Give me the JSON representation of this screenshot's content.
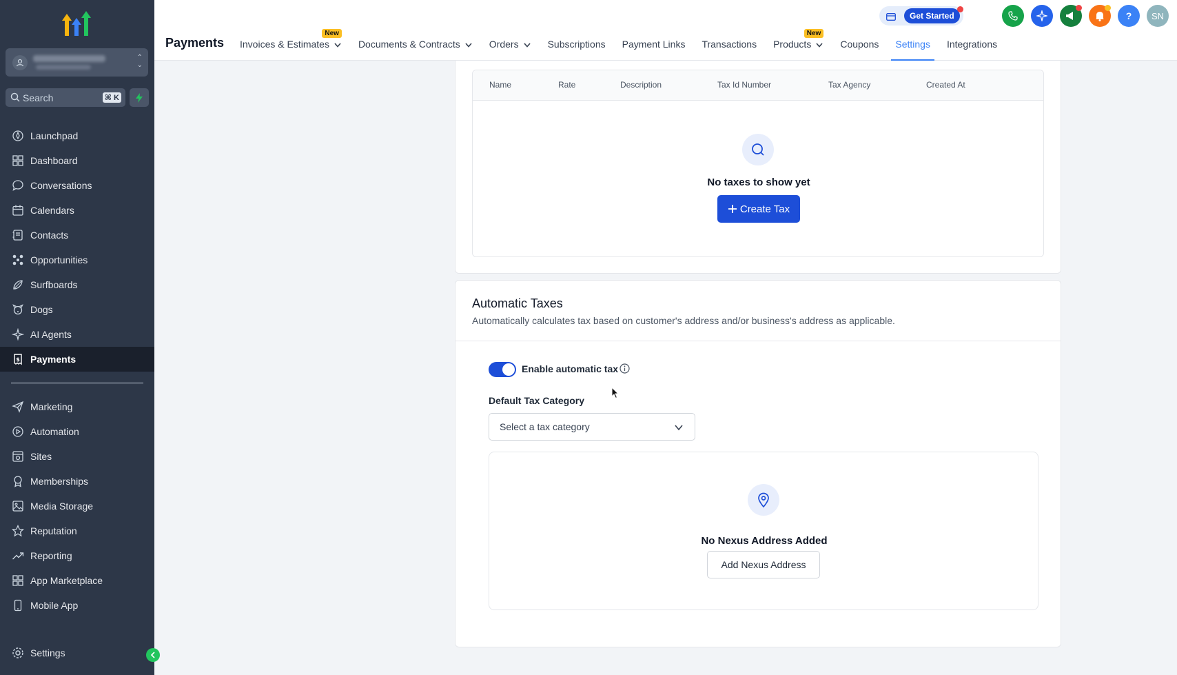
{
  "sidebar": {
    "search_placeholder": "Search",
    "search_shortcut": "⌘ K",
    "items_top": [
      {
        "label": "Launchpad",
        "icon": "launchpad-icon"
      },
      {
        "label": "Dashboard",
        "icon": "dashboard-icon"
      },
      {
        "label": "Conversations",
        "icon": "chat-bubble-icon"
      },
      {
        "label": "Calendars",
        "icon": "calendar-icon"
      },
      {
        "label": "Contacts",
        "icon": "contacts-icon"
      },
      {
        "label": "Opportunities",
        "icon": "opportunities-icon"
      },
      {
        "label": "Surfboards",
        "icon": "surfboard-icon"
      },
      {
        "label": "Dogs",
        "icon": "dog-icon"
      },
      {
        "label": "AI Agents",
        "icon": "sparkle-icon"
      },
      {
        "label": "Payments",
        "icon": "receipt-icon"
      }
    ],
    "items_bottom": [
      {
        "label": "Marketing",
        "icon": "paper-plane-icon"
      },
      {
        "label": "Automation",
        "icon": "automation-icon"
      },
      {
        "label": "Sites",
        "icon": "sites-icon"
      },
      {
        "label": "Memberships",
        "icon": "award-icon"
      },
      {
        "label": "Media Storage",
        "icon": "image-icon"
      },
      {
        "label": "Reputation",
        "icon": "star-icon"
      },
      {
        "label": "Reporting",
        "icon": "trending-up-icon"
      },
      {
        "label": "App Marketplace",
        "icon": "grid-icon"
      },
      {
        "label": "Mobile App",
        "icon": "mobile-icon"
      }
    ],
    "settings_label": "Settings",
    "active": "Payments"
  },
  "header": {
    "title": "Payments",
    "tabs": [
      {
        "label": "Invoices & Estimates",
        "dropdown": true,
        "badge": "New"
      },
      {
        "label": "Documents & Contracts",
        "dropdown": true,
        "badge": ""
      },
      {
        "label": "Orders",
        "dropdown": true,
        "badge": ""
      },
      {
        "label": "Subscriptions",
        "dropdown": false,
        "badge": ""
      },
      {
        "label": "Payment Links",
        "dropdown": false,
        "badge": ""
      },
      {
        "label": "Transactions",
        "dropdown": false,
        "badge": ""
      },
      {
        "label": "Products",
        "dropdown": true,
        "badge": "New"
      },
      {
        "label": "Coupons",
        "dropdown": false,
        "badge": ""
      },
      {
        "label": "Settings",
        "dropdown": false,
        "badge": ""
      },
      {
        "label": "Integrations",
        "dropdown": false,
        "badge": ""
      }
    ],
    "active_tab": "Settings",
    "get_started": "Get Started",
    "avatar_initials": "SN"
  },
  "taxes_table": {
    "columns": [
      "Name",
      "Rate",
      "Description",
      "Tax Id Number",
      "Tax Agency",
      "Created At"
    ],
    "empty_title": "No taxes to show yet",
    "create_button": "Create Tax"
  },
  "automatic_taxes": {
    "title": "Automatic Taxes",
    "subtitle": "Automatically calculates tax based on customer's address and/or business's address as applicable.",
    "toggle_label": "Enable automatic tax",
    "toggle_on": true,
    "category_label": "Default Tax Category",
    "category_placeholder": "Select a tax category",
    "nexus_empty_title": "No Nexus Address Added",
    "nexus_button": "Add Nexus Address"
  },
  "colors": {
    "sidebar_bg": "#2d3748",
    "primary": "#1d4ed8",
    "active_tab": "#3b82f6",
    "badge": "#fbbf24"
  }
}
